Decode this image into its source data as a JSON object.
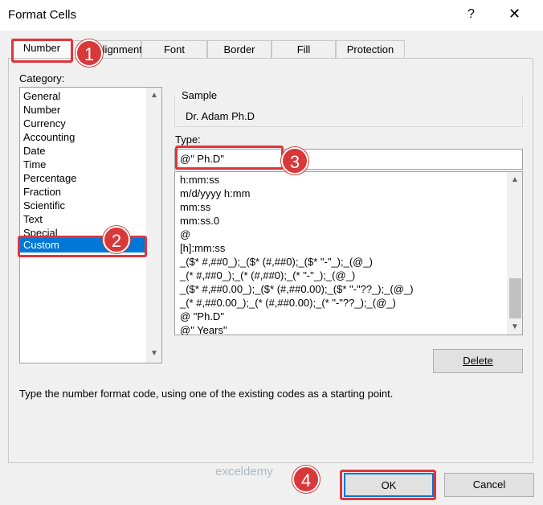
{
  "window": {
    "title": "Format Cells",
    "help": "?",
    "close": "✕"
  },
  "tabs": [
    "Number",
    "Alignment",
    "Font",
    "Border",
    "Fill",
    "Protection"
  ],
  "category": {
    "label": "Category:",
    "items": [
      "General",
      "Number",
      "Currency",
      "Accounting",
      "Date",
      "Time",
      "Percentage",
      "Fraction",
      "Scientific",
      "Text",
      "Special",
      "Custom"
    ],
    "selected": "Custom"
  },
  "sample": {
    "label": "Sample",
    "value": "Dr. Adam Ph.D"
  },
  "type": {
    "label": "Type:",
    "value": "@\" Ph.D\"",
    "formats": [
      "h:mm:ss",
      "m/d/yyyy h:mm",
      "mm:ss",
      "mm:ss.0",
      "@",
      "[h]:mm:ss",
      "_($* #,##0_);_($* (#,##0);_($* \"-\"_);_(@_)",
      "_(* #,##0_);_(* (#,##0);_(* \"-\"_);_(@_)",
      "_($* #,##0.00_);_($* (#,##0.00);_($* \"-\"??_);_(@_)",
      "_(* #,##0.00_);_(* (#,##0.00);_(* \"-\"??_);_(@_)",
      "@ \"Ph.D\"",
      "@\" Years\""
    ]
  },
  "buttons": {
    "delete": "Delete",
    "ok": "OK",
    "cancel": "Cancel"
  },
  "hint": "Type the number format code, using one of the existing codes as a starting point.",
  "badges": [
    "1",
    "2",
    "3",
    "4"
  ],
  "watermark": "exceldemy",
  "colors": {
    "selection": "#0078d7",
    "highlight": "#e0343a",
    "badge": "#d9383a"
  }
}
